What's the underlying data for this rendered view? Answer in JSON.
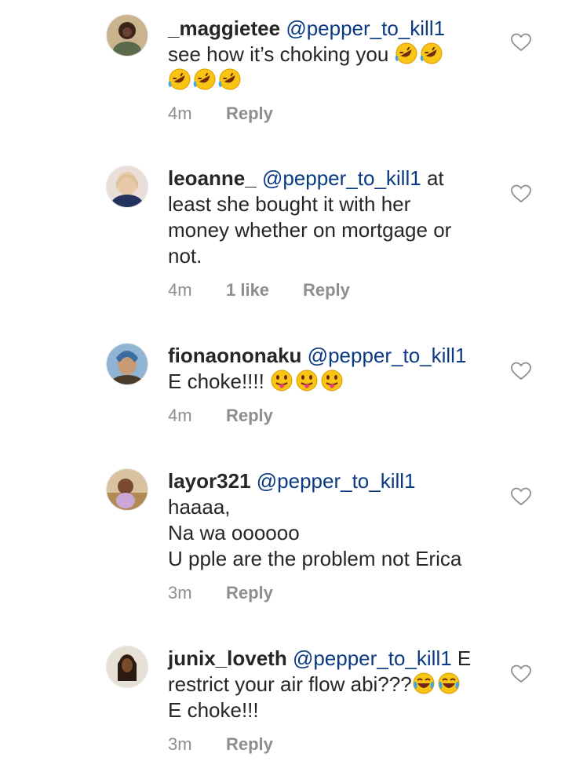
{
  "comments": [
    {
      "username": "_maggietee",
      "mention": "@pepper_to_kill1",
      "lines": [
        "see how it’s choking you",
        ""
      ],
      "emojis": {
        "line0": [
          "rolling-laughing",
          "rolling-laughing"
        ],
        "line1": [
          "rolling-laughing",
          "rolling-laughing",
          "rolling-laughing"
        ]
      },
      "time": "4m",
      "likes": "",
      "reply": "Reply"
    },
    {
      "username": "leoanne_",
      "mention": "@pepper_to_kill1",
      "first_suffix": "at",
      "lines": [
        "least she bought it with her",
        "money whether on mortgage or",
        "not."
      ],
      "time": "4m",
      "likes": "1 like",
      "reply": "Reply"
    },
    {
      "username": "fionaononaku",
      "mention": "@pepper_to_kill1",
      "lines": [
        "E choke!!!!"
      ],
      "emojis": {
        "line0": [
          "tongue",
          "tongue",
          "tongue"
        ]
      },
      "time": "4m",
      "likes": "",
      "reply": "Reply"
    },
    {
      "username": "layor321",
      "mention": "@pepper_to_kill1",
      "lines": [
        "haaaa,",
        "Na wa oooooo",
        "U pple are the problem not Erica"
      ],
      "time": "3m",
      "likes": "",
      "reply": "Reply"
    },
    {
      "username": "junix_loveth",
      "mention": "@pepper_to_kill1",
      "first_suffix": "E",
      "lines": [
        "restrict your air flow abi???",
        "E choke!!!"
      ],
      "emojis": {
        "line0": [
          "tears-of-joy",
          "tears-of-joy"
        ]
      },
      "time": "3m",
      "likes": "",
      "reply": "Reply"
    }
  ],
  "colors": {
    "mention": "#0a3a82",
    "meta": "#8e8e8e",
    "text": "#262626"
  }
}
